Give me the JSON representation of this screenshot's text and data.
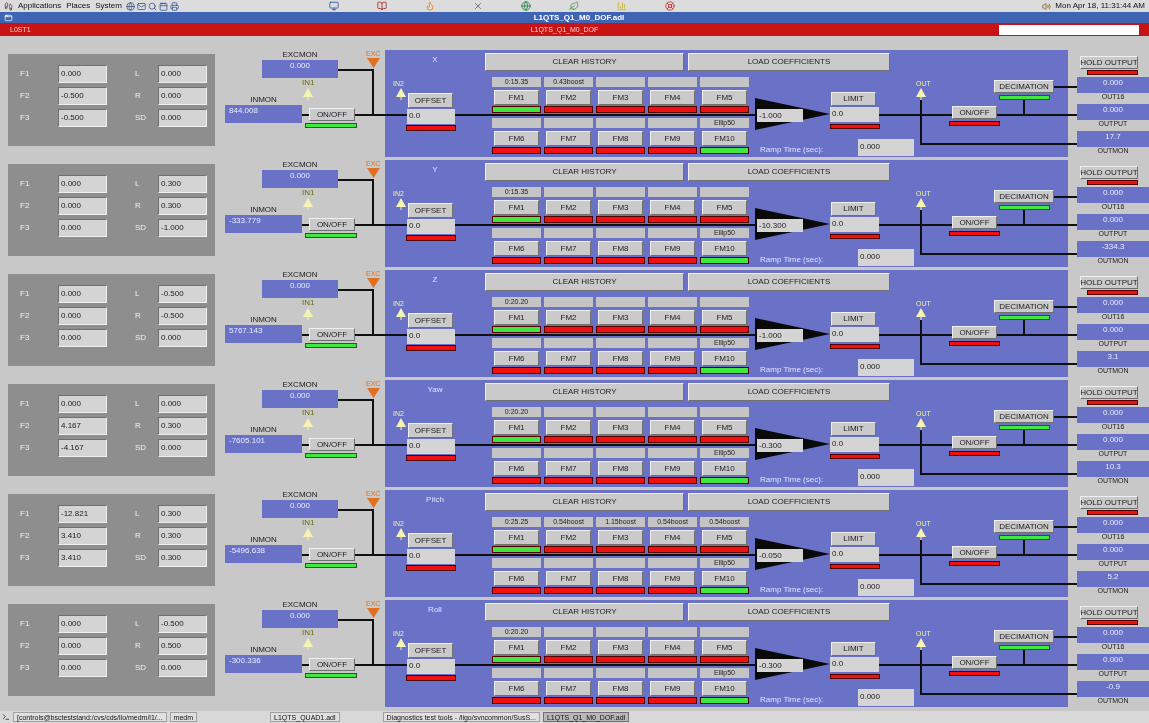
{
  "top_panel": {
    "menus": [
      "Applications",
      "Places",
      "System"
    ],
    "clock": "Mon Apr 18, 11:31:44 AM"
  },
  "window": {
    "title": "L1QTS_Q1_M0_DOF.adl"
  },
  "header": {
    "left": "L0ST1",
    "center": "L1QTS_Q1_M0_DOF"
  },
  "rows": [
    {
      "name": "X",
      "params": [
        {
          "label": "F1",
          "value": "0.000"
        },
        {
          "label": "L",
          "value": "0.000"
        },
        {
          "label": "F2",
          "value": "-0.500"
        },
        {
          "label": "R",
          "value": "0.000"
        },
        {
          "label": "F3",
          "value": "-0.500"
        },
        {
          "label": "SD",
          "value": "0.000"
        }
      ],
      "excmon": {
        "label": "EXCMON",
        "value": "0.000"
      },
      "exc_label": "EXC",
      "inmon": {
        "label": "INMON",
        "value": "844.008"
      },
      "in1_label": "IN1",
      "input_switch": {
        "label": "ON/OFF",
        "on": true
      },
      "in2_label": "IN2",
      "offset": {
        "label": "OFFSET",
        "value": "0.0",
        "on": false
      },
      "clear_history": "CLEAR HISTORY",
      "load_coefficients": "LOAD COEFFICIENTS",
      "filters": [
        {
          "note": "0:15.35",
          "label": "FM1",
          "on": true
        },
        {
          "note": "0.43boost",
          "label": "FM2",
          "on": false
        },
        {
          "label": "FM3",
          "on": false
        },
        {
          "label": "FM4",
          "on": false
        },
        {
          "label": "FM5",
          "on": false
        },
        {
          "label": "FM6",
          "on": false
        },
        {
          "label": "FM7",
          "on": false
        },
        {
          "label": "FM8",
          "on": false
        },
        {
          "label": "FM9",
          "on": false
        },
        {
          "note": "Ellip50",
          "label": "FM10",
          "on": true
        }
      ],
      "gain": "-1.000",
      "limit": {
        "label": "LIMIT",
        "value": "0.0",
        "on": false
      },
      "ramp": {
        "label": "Ramp Time (sec):",
        "value": "0.000"
      },
      "out_label": "OUT",
      "output_switch": {
        "label": "ON/OFF",
        "on": false
      },
      "decimation": {
        "label": "DECIMATION",
        "on": true
      },
      "hold_output": {
        "label": "HOLD OUTPUT",
        "on": false
      },
      "readouts": [
        {
          "value": "0.000",
          "label": "OUT16"
        },
        {
          "value": "0.000",
          "label": "OUTPUT"
        },
        {
          "value": "17.7",
          "label": "OUTMON"
        }
      ]
    },
    {
      "name": "Y",
      "params": [
        {
          "label": "F1",
          "value": "0.000"
        },
        {
          "label": "L",
          "value": "0.300"
        },
        {
          "label": "F2",
          "value": "0.000"
        },
        {
          "label": "R",
          "value": "0.300"
        },
        {
          "label": "F3",
          "value": "0.000"
        },
        {
          "label": "SD",
          "value": "-1.000"
        }
      ],
      "excmon": {
        "label": "EXCMON",
        "value": "0.000"
      },
      "exc_label": "EXC",
      "inmon": {
        "label": "INMON",
        "value": "-333.779"
      },
      "in1_label": "IN1",
      "input_switch": {
        "label": "ON/OFF",
        "on": true
      },
      "in2_label": "IN2",
      "offset": {
        "label": "OFFSET",
        "value": "0.0",
        "on": false
      },
      "clear_history": "CLEAR HISTORY",
      "load_coefficients": "LOAD COEFFICIENTS",
      "filters": [
        {
          "note": "0:15.35",
          "label": "FM1",
          "on": true
        },
        {
          "label": "FM2",
          "on": false
        },
        {
          "label": "FM3",
          "on": false
        },
        {
          "label": "FM4",
          "on": false
        },
        {
          "label": "FM5",
          "on": false
        },
        {
          "label": "FM6",
          "on": false
        },
        {
          "label": "FM7",
          "on": false
        },
        {
          "label": "FM8",
          "on": false
        },
        {
          "label": "FM9",
          "on": false
        },
        {
          "note": "Ellip50",
          "label": "FM10",
          "on": true
        }
      ],
      "gain": "-10.300",
      "limit": {
        "label": "LIMIT",
        "value": "0.0",
        "on": false
      },
      "ramp": {
        "label": "Ramp Time (sec):",
        "value": "0.000"
      },
      "out_label": "OUT",
      "output_switch": {
        "label": "ON/OFF",
        "on": false
      },
      "decimation": {
        "label": "DECIMATION",
        "on": true
      },
      "hold_output": {
        "label": "HOLD OUTPUT",
        "on": false
      },
      "readouts": [
        {
          "value": "0.000",
          "label": "OUT16"
        },
        {
          "value": "0.000",
          "label": "OUTPUT"
        },
        {
          "value": "-334.3",
          "label": "OUTMON"
        }
      ]
    },
    {
      "name": "Z",
      "params": [
        {
          "label": "F1",
          "value": "0.000"
        },
        {
          "label": "L",
          "value": "-0.500"
        },
        {
          "label": "F2",
          "value": "0.000"
        },
        {
          "label": "R",
          "value": "-0.500"
        },
        {
          "label": "F3",
          "value": "0.000"
        },
        {
          "label": "SD",
          "value": "0.000"
        }
      ],
      "excmon": {
        "label": "EXCMON",
        "value": "0.000"
      },
      "exc_label": "EXC",
      "inmon": {
        "label": "INMON",
        "value": "5767.143"
      },
      "in1_label": "IN1",
      "input_switch": {
        "label": "ON/OFF",
        "on": true
      },
      "in2_label": "IN2",
      "offset": {
        "label": "OFFSET",
        "value": "0.0",
        "on": false
      },
      "clear_history": "CLEAR HISTORY",
      "load_coefficients": "LOAD COEFFICIENTS",
      "filters": [
        {
          "note": "0:20.20",
          "label": "FM1",
          "on": true
        },
        {
          "label": "FM2",
          "on": false
        },
        {
          "label": "FM3",
          "on": false
        },
        {
          "label": "FM4",
          "on": false
        },
        {
          "label": "FM5",
          "on": false
        },
        {
          "label": "FM6",
          "on": false
        },
        {
          "label": "FM7",
          "on": false
        },
        {
          "label": "FM8",
          "on": false
        },
        {
          "label": "FM9",
          "on": false
        },
        {
          "note": "Ellip50",
          "label": "FM10",
          "on": true
        }
      ],
      "gain": "-1.000",
      "limit": {
        "label": "LIMIT",
        "value": "0.0",
        "on": false
      },
      "ramp": {
        "label": "Ramp Time (sec):",
        "value": "0.000"
      },
      "out_label": "OUT",
      "output_switch": {
        "label": "ON/OFF",
        "on": false
      },
      "decimation": {
        "label": "DECIMATION",
        "on": true
      },
      "hold_output": {
        "label": "HOLD OUTPUT",
        "on": false
      },
      "readouts": [
        {
          "value": "0.000",
          "label": "OUT16"
        },
        {
          "value": "0.000",
          "label": "OUTPUT"
        },
        {
          "value": "3.1",
          "label": "OUTMON"
        }
      ]
    },
    {
      "name": "Yaw",
      "params": [
        {
          "label": "F1",
          "value": "0.000"
        },
        {
          "label": "L",
          "value": "0.000"
        },
        {
          "label": "F2",
          "value": "4.167"
        },
        {
          "label": "R",
          "value": "0.300"
        },
        {
          "label": "F3",
          "value": "-4.167"
        },
        {
          "label": "SD",
          "value": "0.000"
        }
      ],
      "excmon": {
        "label": "EXCMON",
        "value": "0.000"
      },
      "exc_label": "EXC",
      "inmon": {
        "label": "INMON",
        "value": "-7605.101"
      },
      "in1_label": "IN1",
      "input_switch": {
        "label": "ON/OFF",
        "on": true
      },
      "in2_label": "IN2",
      "offset": {
        "label": "OFFSET",
        "value": "0.0",
        "on": false
      },
      "clear_history": "CLEAR HISTORY",
      "load_coefficients": "LOAD COEFFICIENTS",
      "filters": [
        {
          "note": "0:20.20",
          "label": "FM1",
          "on": true
        },
        {
          "label": "FM2",
          "on": false
        },
        {
          "label": "FM3",
          "on": false
        },
        {
          "label": "FM4",
          "on": false
        },
        {
          "label": "FM5",
          "on": false
        },
        {
          "label": "FM6",
          "on": false
        },
        {
          "label": "FM7",
          "on": false
        },
        {
          "label": "FM8",
          "on": false
        },
        {
          "label": "FM9",
          "on": false
        },
        {
          "note": "Ellip50",
          "label": "FM10",
          "on": true
        }
      ],
      "gain": "-0.300",
      "limit": {
        "label": "LIMIT",
        "value": "0.0",
        "on": false
      },
      "ramp": {
        "label": "Ramp Time (sec):",
        "value": "0.000"
      },
      "out_label": "OUT",
      "output_switch": {
        "label": "ON/OFF",
        "on": false
      },
      "decimation": {
        "label": "DECIMATION",
        "on": true
      },
      "hold_output": {
        "label": "HOLD OUTPUT",
        "on": false
      },
      "readouts": [
        {
          "value": "0.000",
          "label": "OUT16"
        },
        {
          "value": "0.000",
          "label": "OUTPUT"
        },
        {
          "value": "10.3",
          "label": "OUTMON"
        }
      ]
    },
    {
      "name": "Pitch",
      "params": [
        {
          "label": "F1",
          "value": "-12.821"
        },
        {
          "label": "L",
          "value": "0.300"
        },
        {
          "label": "F2",
          "value": "3.410"
        },
        {
          "label": "R",
          "value": "0.300"
        },
        {
          "label": "F3",
          "value": "3.410"
        },
        {
          "label": "SD",
          "value": "0.300"
        }
      ],
      "excmon": {
        "label": "EXCMON",
        "value": "0.000"
      },
      "exc_label": "EXC",
      "inmon": {
        "label": "INMON",
        "value": "-5496.638"
      },
      "in1_label": "IN1",
      "input_switch": {
        "label": "ON/OFF",
        "on": true
      },
      "in2_label": "IN2",
      "offset": {
        "label": "OFFSET",
        "value": "0.0",
        "on": false
      },
      "clear_history": "CLEAR HISTORY",
      "load_coefficients": "LOAD COEFFICIENTS",
      "filters": [
        {
          "note": "0:25.25",
          "label": "FM1",
          "on": true
        },
        {
          "note": "0.54boost",
          "label": "FM2",
          "on": false
        },
        {
          "note": "1.15boost",
          "label": "FM3",
          "on": false
        },
        {
          "note": "0.54boost",
          "label": "FM4",
          "on": false
        },
        {
          "note": "0.54boost",
          "label": "FM5",
          "on": false
        },
        {
          "label": "FM6",
          "on": false
        },
        {
          "label": "FM7",
          "on": false
        },
        {
          "label": "FM8",
          "on": false
        },
        {
          "label": "FM9",
          "on": false
        },
        {
          "note": "Ellip50",
          "label": "FM10",
          "on": true
        }
      ],
      "gain": "-0.050",
      "limit": {
        "label": "LIMIT",
        "value": "0.0",
        "on": false
      },
      "ramp": {
        "label": "Ramp Time (sec):",
        "value": "0.000"
      },
      "out_label": "OUT",
      "output_switch": {
        "label": "ON/OFF",
        "on": false
      },
      "decimation": {
        "label": "DECIMATION",
        "on": true
      },
      "hold_output": {
        "label": "HOLD OUTPUT",
        "on": false
      },
      "readouts": [
        {
          "value": "0.000",
          "label": "OUT16"
        },
        {
          "value": "0.000",
          "label": "OUTPUT"
        },
        {
          "value": "5.2",
          "label": "OUTMON"
        }
      ]
    },
    {
      "name": "Roll",
      "params": [
        {
          "label": "F1",
          "value": "0.000"
        },
        {
          "label": "L",
          "value": "-0.500"
        },
        {
          "label": "F2",
          "value": "0.000"
        },
        {
          "label": "R",
          "value": "0.500"
        },
        {
          "label": "F3",
          "value": "0.000"
        },
        {
          "label": "SD",
          "value": "0.000"
        }
      ],
      "excmon": {
        "label": "EXCMON",
        "value": "0.000"
      },
      "exc_label": "EXC",
      "inmon": {
        "label": "INMON",
        "value": "-300.336"
      },
      "in1_label": "IN1",
      "input_switch": {
        "label": "ON/OFF",
        "on": true
      },
      "in2_label": "IN2",
      "offset": {
        "label": "OFFSET",
        "value": "0.0",
        "on": false
      },
      "clear_history": "CLEAR HISTORY",
      "load_coefficients": "LOAD COEFFICIENTS",
      "filters": [
        {
          "note": "0:20.20",
          "label": "FM1",
          "on": true
        },
        {
          "label": "FM2",
          "on": false
        },
        {
          "label": "FM3",
          "on": false
        },
        {
          "label": "FM4",
          "on": false
        },
        {
          "label": "FM5",
          "on": false
        },
        {
          "label": "FM6",
          "on": false
        },
        {
          "label": "FM7",
          "on": false
        },
        {
          "label": "FM8",
          "on": false
        },
        {
          "label": "FM9",
          "on": false
        },
        {
          "note": "Ellip50",
          "label": "FM10",
          "on": true
        }
      ],
      "gain": "-0.300",
      "limit": {
        "label": "LIMIT",
        "value": "0.0",
        "on": false
      },
      "ramp": {
        "label": "Ramp Time (sec):",
        "value": "0.000"
      },
      "out_label": "OUT",
      "output_switch": {
        "label": "ON/OFF",
        "on": false
      },
      "decimation": {
        "label": "DECIMATION",
        "on": true
      },
      "hold_output": {
        "label": "HOLD OUTPUT",
        "on": false
      },
      "readouts": [
        {
          "value": "0.000",
          "label": "OUT16"
        },
        {
          "value": "0.000",
          "label": "OUTPUT"
        },
        {
          "value": "-0.9",
          "label": "OUTMON"
        }
      ]
    }
  ],
  "taskbar": [
    {
      "label": "[controls@bscteststand:/cvs/cds/llo/medm/l1/...",
      "selected": false
    },
    {
      "label": "medm",
      "selected": false
    },
    {
      "label": "L1QTS_QUAD1.adl",
      "selected": false
    },
    {
      "label": "Diagnostics test tools - /ligo/svncommon/SusS...",
      "selected": false
    },
    {
      "label": "L1QTS_Q1_M0_DOF.adl",
      "selected": true
    }
  ]
}
